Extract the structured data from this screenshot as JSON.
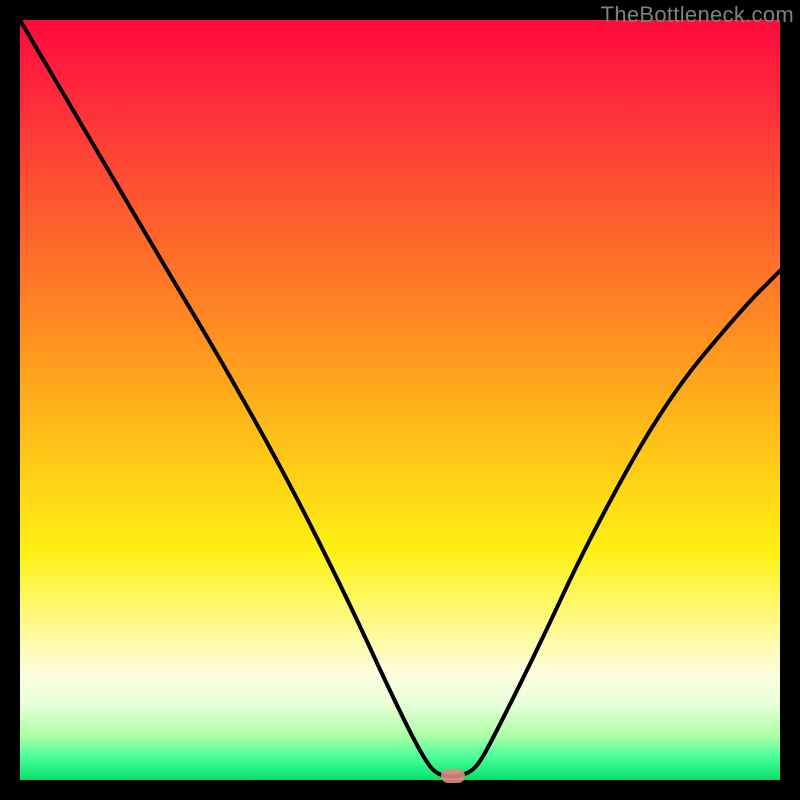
{
  "watermark": "TheBottleneck.com",
  "chart_data": {
    "type": "line",
    "title": "",
    "xlabel": "",
    "ylabel": "",
    "xlim": [
      0,
      100
    ],
    "ylim": [
      0,
      100
    ],
    "series": [
      {
        "name": "curve",
        "x": [
          0,
          10,
          20,
          26,
          35,
          43,
          49,
          53,
          55,
          58,
          60,
          62,
          68,
          75,
          85,
          95,
          100
        ],
        "y": [
          100,
          83,
          66,
          56,
          40,
          24,
          11,
          3,
          0.5,
          0.5,
          1.5,
          5,
          17,
          32,
          50,
          62,
          67
        ]
      }
    ],
    "marker": {
      "x": 57,
      "y": 0.5
    },
    "gradient_stops": [
      {
        "pct": 0,
        "color": "#ff0a3c"
      },
      {
        "pct": 25,
        "color": "#ff5a2e"
      },
      {
        "pct": 55,
        "color": "#ffc018"
      },
      {
        "pct": 80,
        "color": "#fffb90"
      },
      {
        "pct": 100,
        "color": "#04e06a"
      }
    ]
  }
}
